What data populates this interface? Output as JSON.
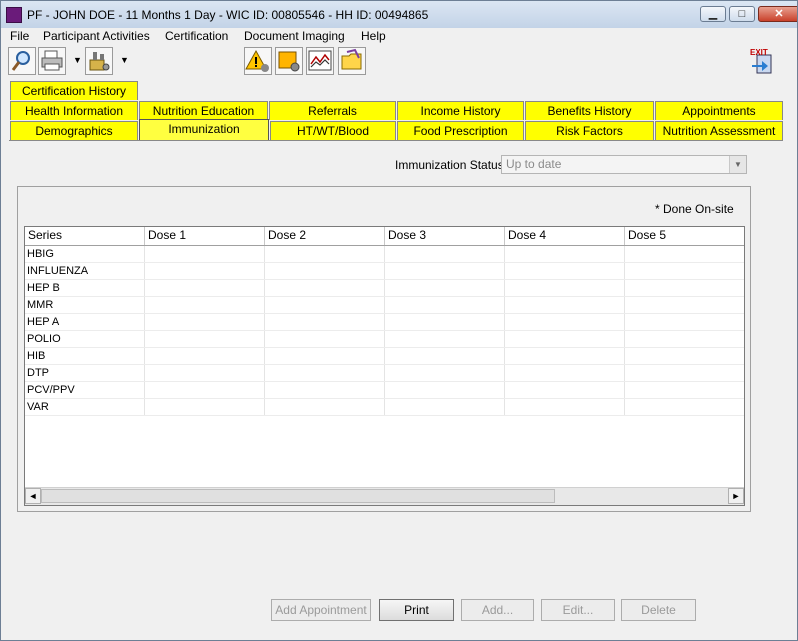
{
  "window": {
    "title": "PF - JOHN DOE - 11 Months 1 Day - WIC ID: 00805546 - HH ID: 00494865",
    "minimize": "▁",
    "maximize": "□",
    "close": "✕"
  },
  "menu": [
    "File",
    "Participant Activities",
    "Certification",
    "Document Imaging",
    "Help"
  ],
  "toolbar": {
    "icons": [
      "search-icon",
      "printer-icon",
      "tools-icon",
      "alert-icon",
      "gear-note-icon",
      "chart-icon",
      "folder-icon",
      "exit-icon"
    ],
    "dropdown_glyph": "▼",
    "exit_label": "EXIT"
  },
  "tabs": {
    "row_top": [
      "Certification History"
    ],
    "row_middle": [
      "Health Information",
      "Nutrition Education",
      "Referrals",
      "Income History",
      "Benefits History",
      "Appointments"
    ],
    "row_bottom": [
      "Demographics",
      "Immunization",
      "HT/WT/Blood",
      "Food Prescription",
      "Risk Factors",
      "Nutrition Assessment"
    ],
    "active": "Immunization",
    "tab_color": "#ffff00"
  },
  "immunization_status": {
    "label": "Immunization Status",
    "value": "Up to date"
  },
  "done_onsite": "* Done On-site",
  "grid": {
    "columns": [
      "Series",
      "Dose 1",
      "Dose 2",
      "Dose 3",
      "Dose 4",
      "Dose 5"
    ],
    "rows": [
      "HBIG",
      "INFLUENZA",
      "HEP B",
      "MMR",
      "HEP A",
      "POLIO",
      "HIB",
      "DTP",
      "PCV/PPV",
      "VAR"
    ],
    "scroll_left": "◄",
    "scroll_right": "►"
  },
  "buttons": {
    "add_appointment": "Add Appointment",
    "print": "Print",
    "add": "Add...",
    "edit": "Edit...",
    "delete": "Delete"
  }
}
